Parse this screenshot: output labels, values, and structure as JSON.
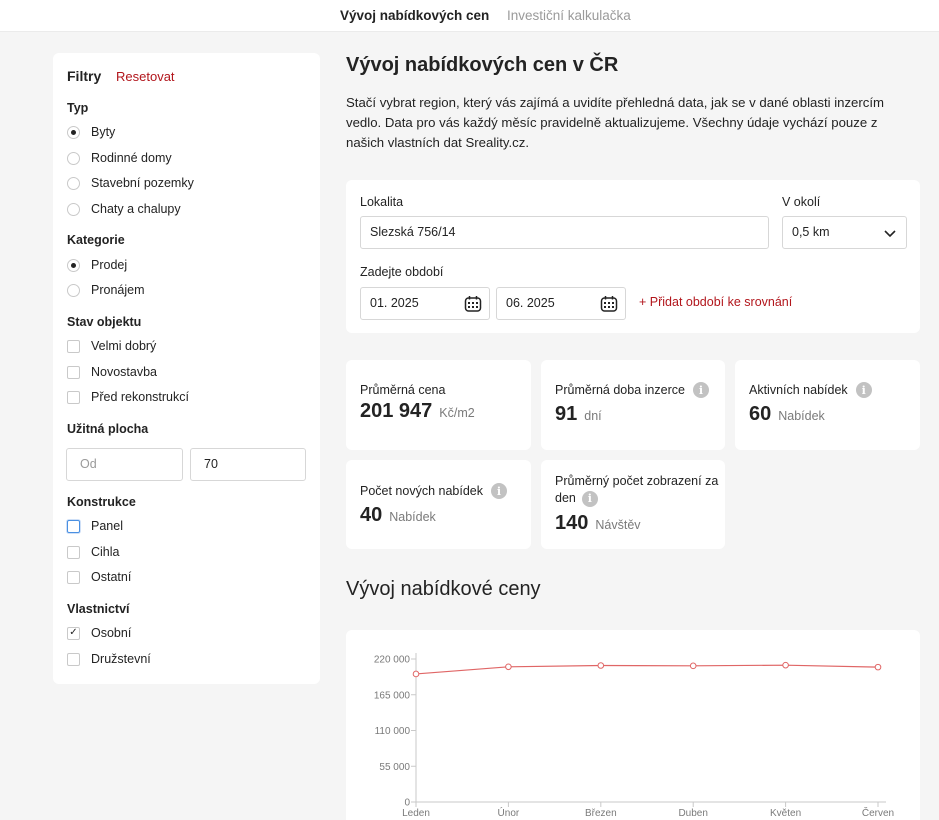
{
  "tabs": [
    {
      "label": "Vývoj nabídkových cen",
      "active": true
    },
    {
      "label": "Investiční kalkulačka",
      "active": false
    }
  ],
  "filters": {
    "title": "Filtry",
    "reset_label": "Resetovat",
    "groups": {
      "typ": {
        "title": "Typ",
        "options": [
          "Byty",
          "Rodinné domy",
          "Stavební pozemky",
          "Chaty a chalupy"
        ],
        "selected": "Byty"
      },
      "kategorie": {
        "title": "Kategorie",
        "options": [
          "Prodej",
          "Pronájem"
        ],
        "selected": "Prodej"
      },
      "stav": {
        "title": "Stav objektu",
        "options": [
          "Velmi dobrý",
          "Novostavba",
          "Před rekonstrukcí"
        ]
      },
      "plocha": {
        "title": "Užitná plocha",
        "from_placeholder": "Od",
        "to_value": "70"
      },
      "konstrukce": {
        "title": "Konstrukce",
        "options": [
          "Panel",
          "Cihla",
          "Ostatní"
        ]
      },
      "vlastnictvi": {
        "title": "Vlastnictví",
        "options": [
          "Osobní",
          "Družstevní"
        ],
        "checked": "Osobní"
      }
    }
  },
  "main": {
    "title": "Vývoj nabídkových cen v ČR",
    "intro": "Stačí vybrat region, který vás zajímá a uvidíte přehledná data, jak se v dané oblasti inzercím vedlo. Data pro vás každý měsíc pravidelně aktualizujeme. Všechny údaje vychází pouze z našich vlastních dat Sreality.cz.",
    "form": {
      "lokalita_label": "Lokalita",
      "lokalita_value": "Slezská 756/14",
      "okoli_label": "V okolí",
      "okoli_value": "0,5 km",
      "obdobi_label": "Zadejte období",
      "from": "01. 2025",
      "to": "06. 2025",
      "add_period": "+ Přidat období ke srovnání"
    },
    "stats": [
      {
        "label": "Průměrná cena",
        "value": "201 947",
        "unit": "Kč/m2",
        "info": false
      },
      {
        "label": "Průměrná doba inzerce",
        "value": "91",
        "unit": "dní",
        "info": true
      },
      {
        "label": "Aktivních nabídek",
        "value": "60",
        "unit": "Nabídek",
        "info": true
      },
      {
        "label": "Počet nových nabídek",
        "value": "40",
        "unit": "Nabídek",
        "info": true
      },
      {
        "label": "Průměrný počet zobrazení za den",
        "value": "140",
        "unit": "Návštěv",
        "info": true
      }
    ],
    "chart_title": "Vývoj nabídkové ceny"
  },
  "chart_data": {
    "type": "line",
    "categories": [
      "Leden",
      "Únor",
      "Březen",
      "Duben",
      "Květen",
      "Červen"
    ],
    "series": [
      {
        "values": [
          197000,
          208000,
          210000,
          209500,
          210500,
          207500
        ]
      }
    ],
    "yticks": [
      0,
      55000,
      110000,
      165000,
      220000
    ],
    "ytick_labels": [
      "0",
      "55 000",
      "110 000",
      "165 000",
      "220 000"
    ],
    "ylim": [
      0,
      220000
    ],
    "color": "#e06666",
    "grid": false
  }
}
